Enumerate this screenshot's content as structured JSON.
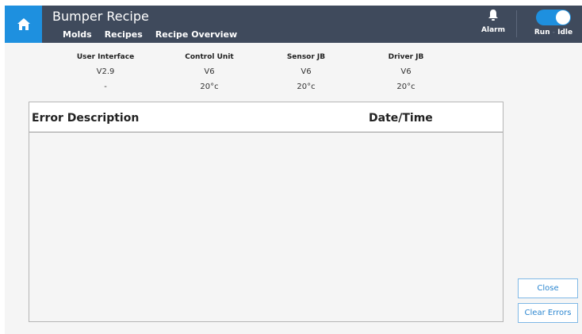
{
  "header": {
    "title": "Bumper Recipe",
    "tabs": [
      {
        "label": "Molds"
      },
      {
        "label": "Recipes"
      },
      {
        "label": "Recipe Overview",
        "active": true
      }
    ],
    "alarm_label": "Alarm",
    "run_label": "Run",
    "separator": "-",
    "idle_label": "Idle",
    "icons": {
      "home": "home-icon",
      "alarm": "bell-icon",
      "toggle": "toggle-switch"
    },
    "colors": {
      "bar": "#3f4a5c",
      "accent": "#1e90df"
    }
  },
  "versions": [
    {
      "heading": "User Interface",
      "version": "V2.9",
      "temp": "-"
    },
    {
      "heading": "Control Unit",
      "version": "V6",
      "temp": "20°c"
    },
    {
      "heading": "Sensor JB",
      "version": "V6",
      "temp": "20°c"
    },
    {
      "heading": "Driver JB",
      "version": "V6",
      "temp": "20°c"
    }
  ],
  "errors": {
    "col_description": "Error Description",
    "col_datetime": "Date/Time",
    "rows": []
  },
  "buttons": {
    "close": "Close",
    "clear_errors": "Clear Errors"
  }
}
